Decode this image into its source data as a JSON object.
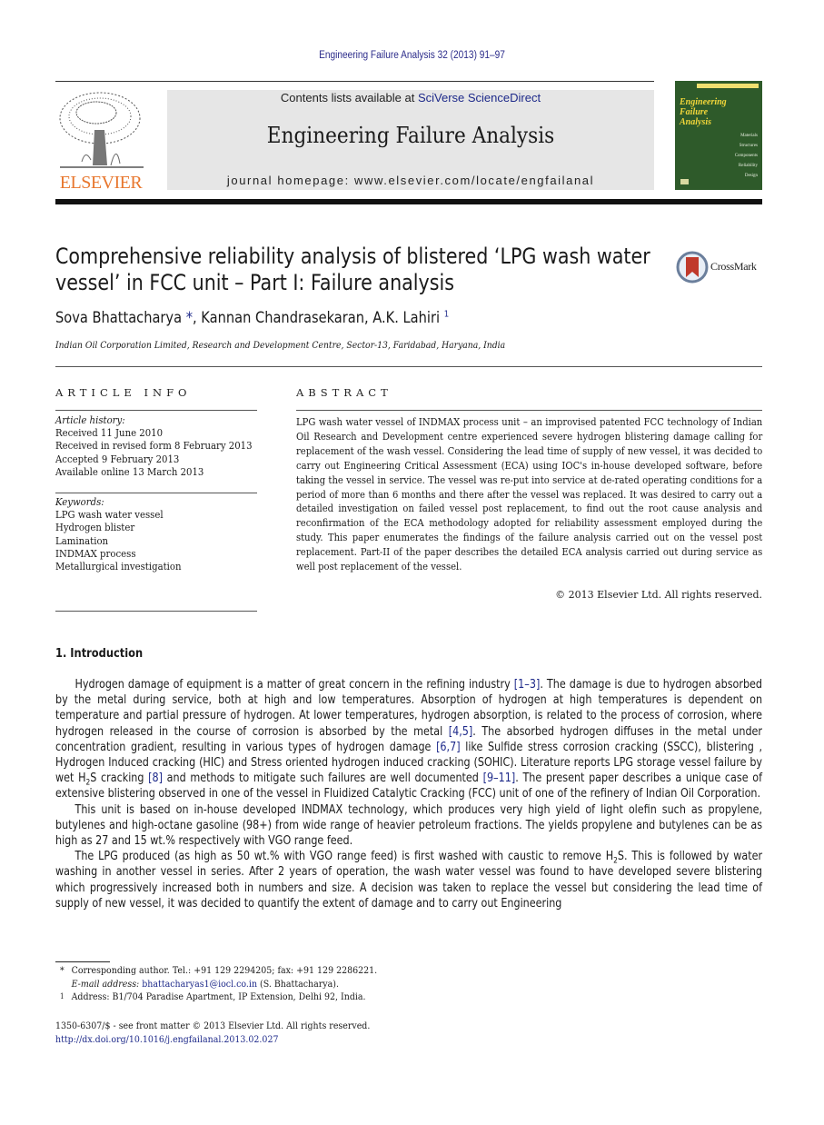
{
  "header": {
    "journal_reference": "Engineering Failure Analysis 32 (2013) 91–97",
    "contents_prefix": "Contents lists available at ",
    "contents_link": "SciVerse ScienceDirect",
    "journal_name": "Engineering Failure Analysis",
    "homepage": "journal homepage: www.elsevier.com/locate/engfailanal",
    "publisher_logo_text": "ELSEVIER",
    "cover": {
      "title_lines": [
        "Engineering",
        "Failure",
        "Analysis"
      ],
      "topics": [
        "Materials",
        "Structures",
        "Components",
        "Reliability",
        "Design"
      ]
    }
  },
  "article": {
    "title": "Comprehensive reliability analysis of blistered ‘LPG wash water vessel’ in FCC unit – Part I: Failure analysis",
    "crossmark_label": "CrossMark",
    "authors": [
      {
        "name": "Sova Bhattacharya",
        "mark": "*"
      },
      {
        "name": "Kannan Chandrasekaran",
        "mark": ""
      },
      {
        "name": "A.K. Lahiri",
        "mark": "1"
      }
    ],
    "affiliation": "Indian Oil Corporation Limited, Research and Development Centre, Sector-13, Faridabad, Haryana, India"
  },
  "article_info": {
    "heading": "ARTICLE INFO",
    "history_label": "Article history:",
    "history": [
      "Received 11 June 2010",
      "Received in revised form 8 February 2013",
      "Accepted 9 February 2013",
      "Available online 13 March 2013"
    ],
    "keywords_label": "Keywords:",
    "keywords": [
      "LPG wash water vessel",
      "Hydrogen blister",
      "Lamination",
      "INDMAX process",
      "Metallurgical investigation"
    ]
  },
  "abstract": {
    "heading": "ABSTRACT",
    "text": "LPG wash water vessel of INDMAX process unit – an improvised patented FCC technology of Indian Oil Research and Development centre experienced severe hydrogen blistering damage calling for replacement of the wash vessel. Considering the lead time of supply of new vessel, it was decided to carry out Engineering Critical Assessment (ECA) using IOC's in-house developed software, before taking the vessel in service. The vessel was re-put into service at de-rated operating conditions for a period of more than 6 months and there after the vessel was replaced. It was desired to carry out a detailed investigation on failed vessel post replacement, to find out the root cause analysis and reconfirmation of the ECA methodology adopted for reliability assessment employed during the study. This paper enumerates the findings of the failure analysis carried out on the vessel post replacement. Part-II of the paper describes the detailed ECA analysis carried out during service as well post replacement of the vessel.",
    "copyright": "© 2013 Elsevier Ltd. All rights reserved."
  },
  "introduction": {
    "heading": "1. Introduction",
    "p1": {
      "s1": "Hydrogen damage of equipment is a matter of great concern in the refining industry ",
      "ref1": "[1–3]",
      "s2": ". The damage is due to hydrogen absorbed by the metal during service, both at high and low temperatures. Absorption of hydrogen at high temperatures is dependent on temperature and partial pressure of hydrogen. At lower temperatures, hydrogen absorption, is related to the process of corrosion, where hydrogen released in the course of corrosion is absorbed by the metal ",
      "ref2": "[4,5]",
      "s3": ". The absorbed hydrogen diffuses in the metal under concentration gradient, resulting in various types of hydrogen damage ",
      "ref3": "[6,7]",
      "s4": " like Sulfide stress corrosion cracking (SSCC), blistering , Hydrogen Induced cracking (HIC) and Stress oriented hydrogen induced cracking (SOHIC). Literature reports LPG storage vessel failure by wet H",
      "sub1": "2",
      "s5": "S cracking ",
      "ref4": "[8]",
      "s6": " and methods to mitigate such failures are well documented ",
      "ref5": "[9–11]",
      "s7": ". The present paper describes a unique case of extensive blistering observed in one of the vessel in Fluidized Catalytic Cracking (FCC) unit of one of the refinery of Indian Oil Corporation."
    },
    "p2": "This unit is based on in-house developed INDMAX technology, which produces very high yield of light olefin such as propylene, butylenes and high-octane gasoline (98+) from wide range of heavier petroleum fractions. The yields propylene and butylenes can be as high as 27 and 15 wt.% respectively with VGO range feed.",
    "p3": {
      "s1": "The LPG produced (as high as 50 wt.% with VGO range feed) is first washed with caustic to remove H",
      "sub1": "2",
      "s2": "S. This is followed by water washing in another vessel in series. After 2 years of operation, the wash water vessel was found to have developed severe blistering which progressively increased both in numbers and size. A decision was taken to replace the vessel but considering the lead time of supply of new vessel, it was decided to quantify the extent of damage and to carry out Engineering"
    }
  },
  "footnotes": {
    "corresponding_mark": "*",
    "corresponding_text": "Corresponding author. Tel.: +91 129 2294205; fax: +91 129 2286221.",
    "email_label": "E-mail address:",
    "email": "bhattacharyas1@iocl.co.in",
    "email_suffix": " (S. Bhattacharya).",
    "address_mark": "1",
    "address_text": "Address: B1/704 Paradise Apartment, IP Extension, Delhi 92, India."
  },
  "front_matter": {
    "issn_line": "1350-6307/$ - see front matter © 2013 Elsevier Ltd. All rights reserved.",
    "doi": "http://dx.doi.org/10.1016/j.engfailanal.2013.02.027"
  },
  "colors": {
    "link": "#1e2a8a",
    "elsevier_orange": "#e8772e",
    "masthead_bg": "#e6e6e6",
    "cover_green": "#2e5a2a",
    "cover_title_yellow": "#f2d63a",
    "crossmark_red": "#c0392b"
  }
}
